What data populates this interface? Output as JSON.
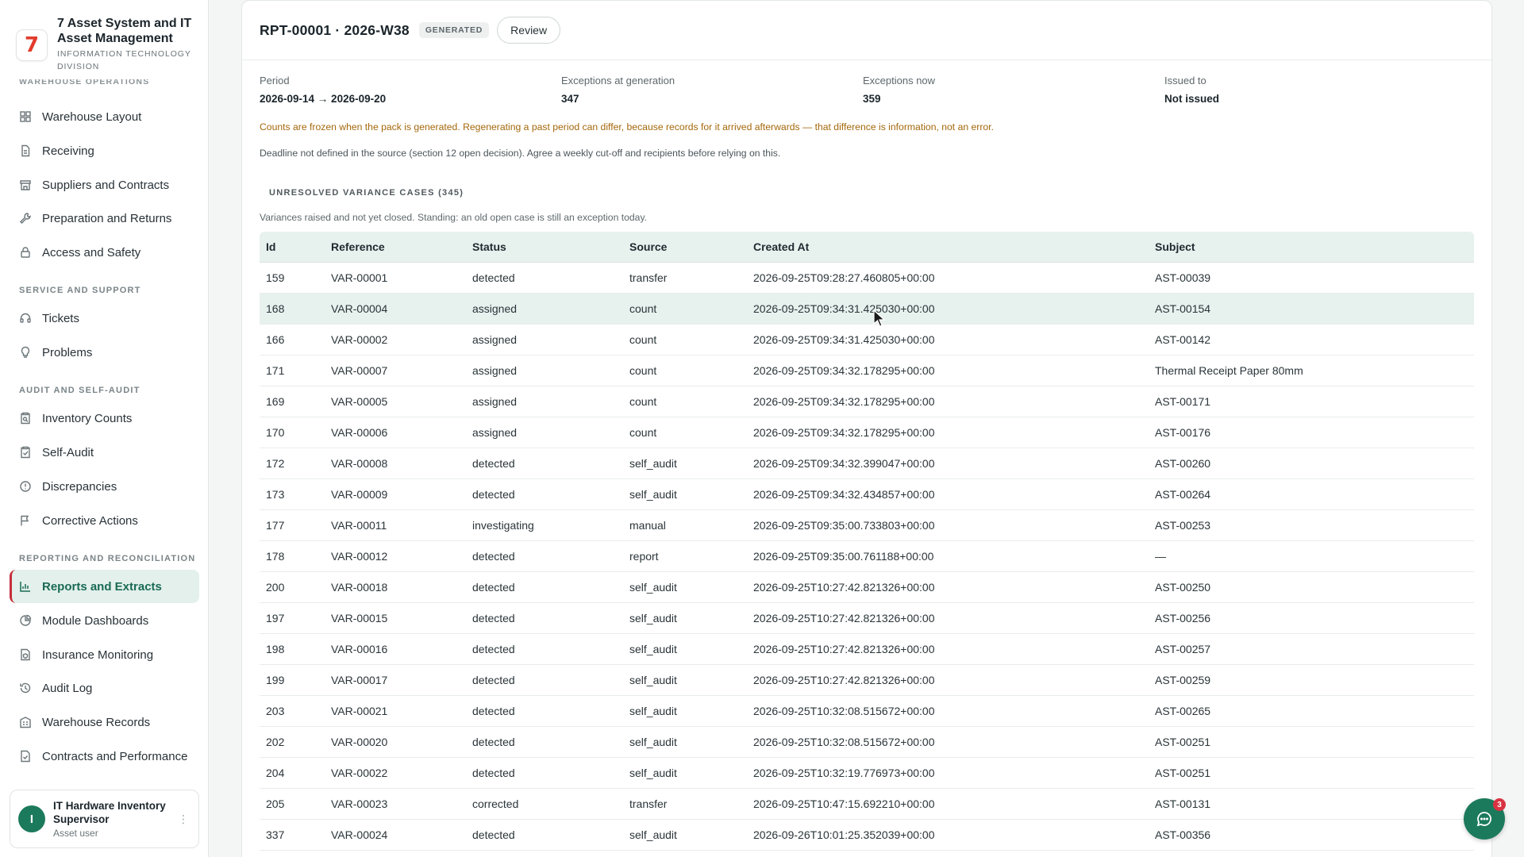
{
  "brand": {
    "title": "7 Asset System and IT Asset Management",
    "subtitle": "INFORMATION TECHNOLOGY DIVISION",
    "logo_text": "7"
  },
  "sidebar": {
    "cut_section": "WAREHOUSE OPERATIONS",
    "sections": [
      {
        "label": "SERVICE AND SUPPORT"
      },
      {
        "label": "AUDIT AND SELF-AUDIT"
      },
      {
        "label": "REPORTING AND RECONCILIATION"
      }
    ],
    "items": [
      {
        "label": "Warehouse Layout",
        "icon": "grid-icon"
      },
      {
        "label": "Receiving",
        "icon": "document-icon"
      },
      {
        "label": "Suppliers and Contracts",
        "icon": "store-icon"
      },
      {
        "label": "Preparation and Returns",
        "icon": "wrench-icon"
      },
      {
        "label": "Access and Safety",
        "icon": "lock-icon"
      },
      {
        "label": "Tickets",
        "icon": "headset-icon"
      },
      {
        "label": "Problems",
        "icon": "lightbulb-icon"
      },
      {
        "label": "Inventory Counts",
        "icon": "clipboard-search-icon"
      },
      {
        "label": "Self-Audit",
        "icon": "clipboard-check-icon"
      },
      {
        "label": "Discrepancies",
        "icon": "alert-circle-icon"
      },
      {
        "label": "Corrective Actions",
        "icon": "flag-icon"
      },
      {
        "label": "Reports and Extracts",
        "icon": "bar-chart-icon",
        "active": true
      },
      {
        "label": "Module Dashboards",
        "icon": "pie-chart-icon"
      },
      {
        "label": "Insurance Monitoring",
        "icon": "file-shield-icon"
      },
      {
        "label": "Audit Log",
        "icon": "history-icon"
      },
      {
        "label": "Warehouse Records",
        "icon": "building-icon"
      },
      {
        "label": "Contracts and Performance",
        "icon": "file-check-icon"
      }
    ]
  },
  "user": {
    "initial": "I",
    "name": "IT Hardware Inventory Supervisor",
    "role": "Asset user"
  },
  "report": {
    "title": "RPT-00001 · 2026-W38",
    "badge": "GENERATED",
    "review_label": "Review",
    "summary": [
      {
        "label": "Period",
        "value": "2026-09-14 → 2026-09-20"
      },
      {
        "label": "Exceptions at generation",
        "value": "347"
      },
      {
        "label": "Exceptions now",
        "value": "359"
      },
      {
        "label": "Issued to",
        "value": "Not issued"
      }
    ],
    "note_warning": "Counts are frozen when the pack is generated. Regenerating a past period can differ, because records for it arrived afterwards — that difference is information, not an error.",
    "note_deadline": "Deadline not defined in the source (section 12 open decision). Agree a weekly cut-off and recipients before relying on this.",
    "section_title": "UNRESOLVED VARIANCE CASES (345)",
    "section_desc": "Variances raised and not yet closed. Standing: an old open case is still an exception today."
  },
  "table": {
    "columns": [
      "Id",
      "Reference",
      "Status",
      "Source",
      "Created At",
      "Subject"
    ],
    "rows": [
      [
        "159",
        "VAR-00001",
        "detected",
        "transfer",
        "2026-09-25T09:28:27.460805+00:00",
        "AST-00039"
      ],
      [
        "168",
        "VAR-00004",
        "assigned",
        "count",
        "2026-09-25T09:34:31.425030+00:00",
        "AST-00154"
      ],
      [
        "166",
        "VAR-00002",
        "assigned",
        "count",
        "2026-09-25T09:34:31.425030+00:00",
        "AST-00142"
      ],
      [
        "171",
        "VAR-00007",
        "assigned",
        "count",
        "2026-09-25T09:34:32.178295+00:00",
        "Thermal Receipt Paper 80mm"
      ],
      [
        "169",
        "VAR-00005",
        "assigned",
        "count",
        "2026-09-25T09:34:32.178295+00:00",
        "AST-00171"
      ],
      [
        "170",
        "VAR-00006",
        "assigned",
        "count",
        "2026-09-25T09:34:32.178295+00:00",
        "AST-00176"
      ],
      [
        "172",
        "VAR-00008",
        "detected",
        "self_audit",
        "2026-09-25T09:34:32.399047+00:00",
        "AST-00260"
      ],
      [
        "173",
        "VAR-00009",
        "detected",
        "self_audit",
        "2026-09-25T09:34:32.434857+00:00",
        "AST-00264"
      ],
      [
        "177",
        "VAR-00011",
        "investigating",
        "manual",
        "2026-09-25T09:35:00.733803+00:00",
        "AST-00253"
      ],
      [
        "178",
        "VAR-00012",
        "detected",
        "report",
        "2026-09-25T09:35:00.761188+00:00",
        "—"
      ],
      [
        "200",
        "VAR-00018",
        "detected",
        "self_audit",
        "2026-09-25T10:27:42.821326+00:00",
        "AST-00250"
      ],
      [
        "197",
        "VAR-00015",
        "detected",
        "self_audit",
        "2026-09-25T10:27:42.821326+00:00",
        "AST-00256"
      ],
      [
        "198",
        "VAR-00016",
        "detected",
        "self_audit",
        "2026-09-25T10:27:42.821326+00:00",
        "AST-00257"
      ],
      [
        "199",
        "VAR-00017",
        "detected",
        "self_audit",
        "2026-09-25T10:27:42.821326+00:00",
        "AST-00259"
      ],
      [
        "203",
        "VAR-00021",
        "detected",
        "self_audit",
        "2026-09-25T10:32:08.515672+00:00",
        "AST-00265"
      ],
      [
        "202",
        "VAR-00020",
        "detected",
        "self_audit",
        "2026-09-25T10:32:08.515672+00:00",
        "AST-00251"
      ],
      [
        "204",
        "VAR-00022",
        "detected",
        "self_audit",
        "2026-09-25T10:32:19.776973+00:00",
        "AST-00251"
      ],
      [
        "205",
        "VAR-00023",
        "corrected",
        "transfer",
        "2026-09-25T10:47:15.692210+00:00",
        "AST-00131"
      ],
      [
        "337",
        "VAR-00024",
        "detected",
        "self_audit",
        "2026-09-26T10:01:25.352039+00:00",
        "AST-00356"
      ]
    ],
    "hover_row": 1
  },
  "chat": {
    "badge_count": "3",
    "icon": "chat-icon"
  },
  "colors": {
    "accent": "#1c7a5c",
    "active_bg": "#e3f0ec",
    "warning": "#a5680c",
    "danger": "#d93342"
  }
}
